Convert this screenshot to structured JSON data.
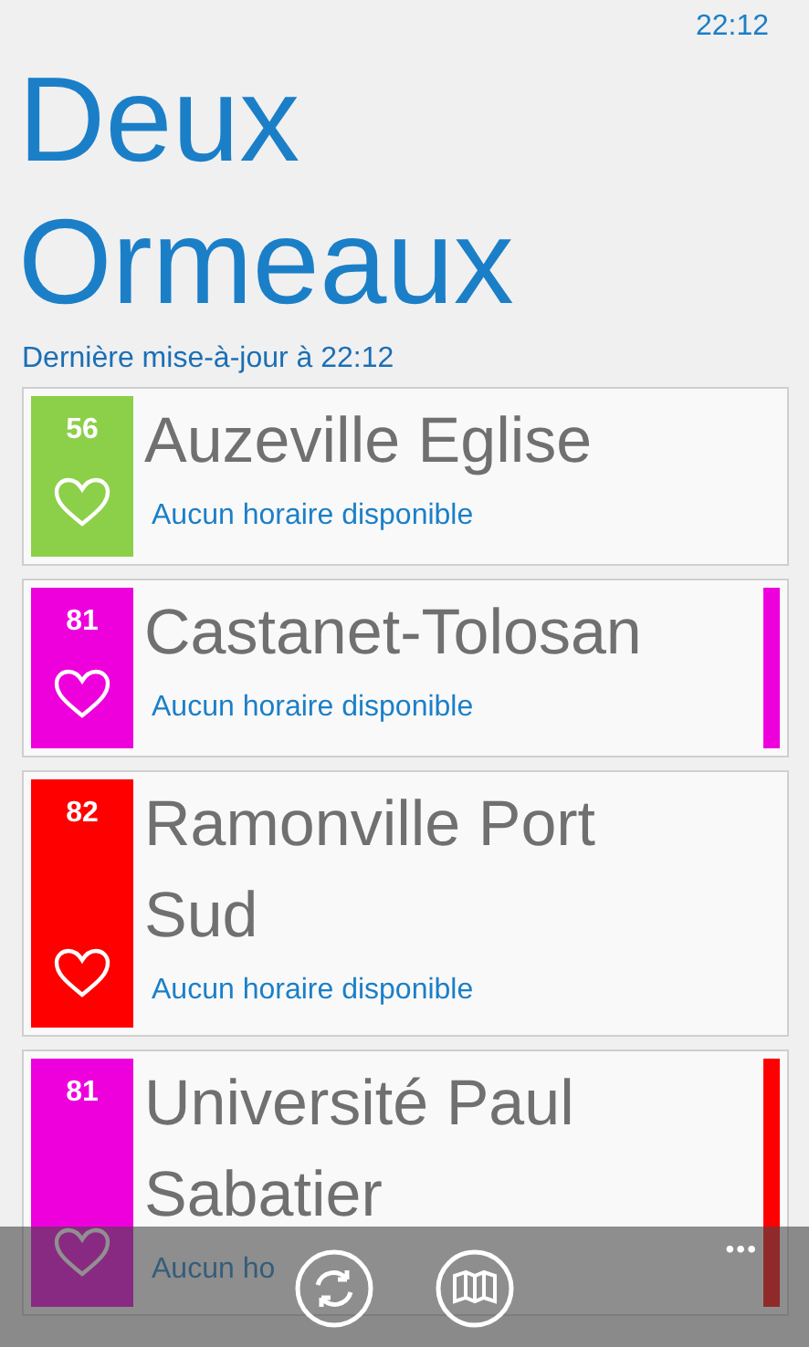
{
  "status_bar": {
    "time": "22:12"
  },
  "title": "Deux Ormeaux",
  "subtitle": "Dernière mise-à-jour à 22:12",
  "stops": [
    {
      "line": "56",
      "color": "#8cd04a",
      "name": "Auzeville Eglise",
      "status": "Aucun horaire disponible",
      "favorite": false
    },
    {
      "line": "81",
      "color": "#ee00dd",
      "name": "Castanet-Tolosan",
      "status": "Aucun horaire disponible",
      "favorite": false,
      "side_strip": {
        "color": "#ee00dd"
      }
    },
    {
      "line": "82",
      "color": "#ff0000",
      "name": "Ramonville Port Sud",
      "status": "Aucun horaire disponible",
      "favorite": false
    },
    {
      "line": "81",
      "color": "#ee00dd",
      "name": "Université Paul Sabatier",
      "status": "Aucun ho",
      "favorite": false,
      "side_strip": {
        "color": "#ff0000"
      }
    }
  ],
  "app_bar": {
    "buttons": [
      {
        "kind": "refresh"
      },
      {
        "kind": "map"
      }
    ],
    "more": "•••"
  }
}
